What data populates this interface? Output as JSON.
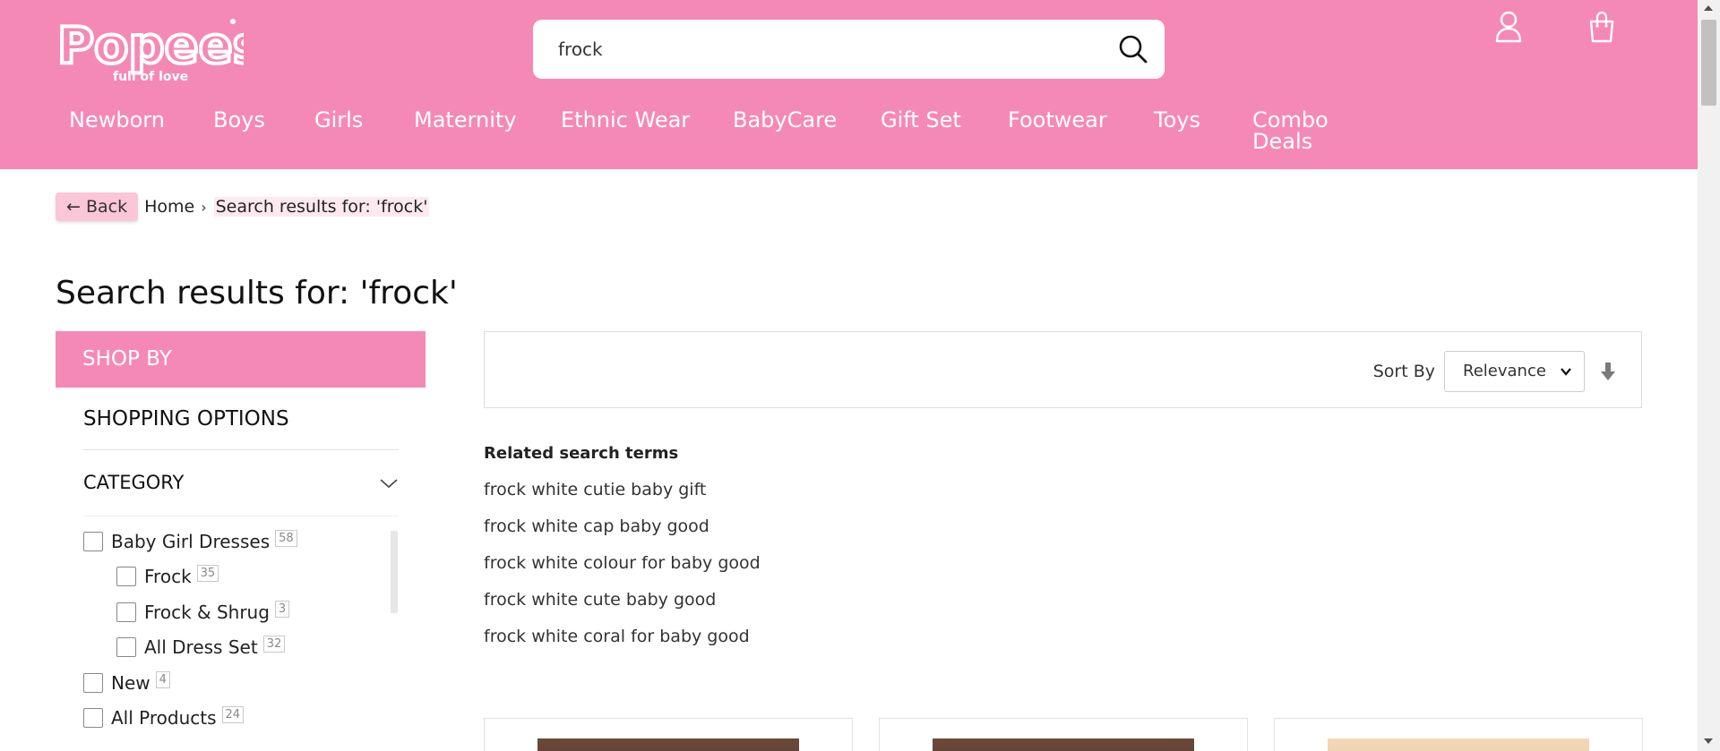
{
  "header": {
    "logo_text": "Popees",
    "logo_tagline": "full of love",
    "search_value": "frock",
    "icons": [
      "search-icon",
      "user-icon",
      "shopping-bag-icon"
    ]
  },
  "nav": [
    "Newborn",
    "Boys",
    "Girls",
    "Maternity",
    "Ethnic Wear",
    "BabyCare",
    "Gift Set",
    "Footwear",
    "Toys",
    "Combo Deals"
  ],
  "breadcrumb": {
    "back": "← Back",
    "home": "Home",
    "current": "Search results for: 'frock'"
  },
  "page_title": "Search results for: 'frock'",
  "sidebar": {
    "shop_by": "SHOP BY",
    "shopping_options": "SHOPPING OPTIONS",
    "category": "CATEGORY",
    "filters": [
      {
        "label": "Baby Girl Dresses",
        "count": "58"
      },
      {
        "label": "Frock",
        "count": "35"
      },
      {
        "label": "Frock & Shrug",
        "count": "3"
      },
      {
        "label": "All Dress Set",
        "count": "32"
      },
      {
        "label": "New",
        "count": "4"
      },
      {
        "label": "All Products",
        "count": "24"
      }
    ]
  },
  "toolbar": {
    "sort_label": "Sort By",
    "sort_value": "Relevance"
  },
  "related": {
    "title": "Related search terms",
    "terms": [
      "frock white cutie baby gift",
      "frock white cap baby good",
      "frock white colour for baby good",
      "frock white cute baby good",
      "frock white coral for baby good"
    ]
  },
  "colors": {
    "brand_pink": "#f589b6",
    "back_button": "#fbc6d7"
  }
}
